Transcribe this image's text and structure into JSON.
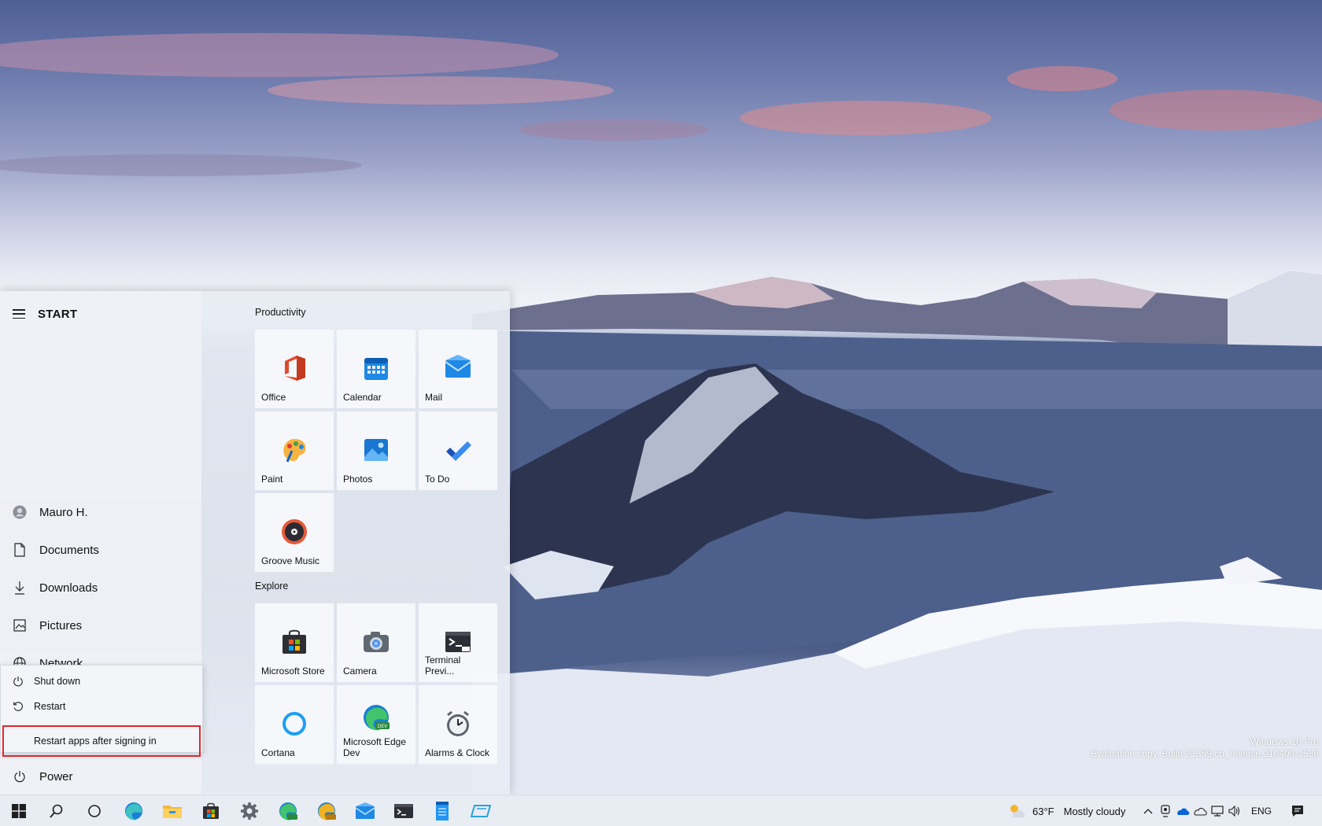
{
  "watermark": {
    "edition": "Windows 10 Pro",
    "build": "Evaluation copy. Build 21359.co_release.210409-1536"
  },
  "start": {
    "title": "START",
    "nav": {
      "user": "Mauro H.",
      "documents": "Documents",
      "downloads": "Downloads",
      "pictures": "Pictures",
      "network": "Network",
      "power": "Power"
    },
    "power_menu": {
      "shutdown": "Shut down",
      "restart": "Restart",
      "restart_apps": "Restart apps after signing in"
    },
    "groups": {
      "productivity": "Productivity",
      "explore": "Explore"
    },
    "tiles": {
      "office": "Office",
      "calendar": "Calendar",
      "mail": "Mail",
      "paint": "Paint",
      "photos": "Photos",
      "todo": "To Do",
      "groove": "Groove Music",
      "store": "Microsoft Store",
      "camera": "Camera",
      "terminal": "Terminal Previ...",
      "cortana": "Cortana",
      "edge_dev": "Microsoft Edge Dev",
      "alarms": "Alarms & Clock"
    }
  },
  "taskbar": {
    "pinned_icons": [
      "windows-logo",
      "search",
      "cortana",
      "edge",
      "file-explorer",
      "store",
      "settings",
      "edge-dev",
      "edge-canary",
      "mail",
      "terminal",
      "notepad",
      "app"
    ],
    "weather": {
      "temperature": "63°F",
      "condition": "Mostly cloudy"
    },
    "language": "ENG"
  },
  "colors": {
    "highlight_border": "#e0262b",
    "accent_blue": "#0078d4"
  }
}
